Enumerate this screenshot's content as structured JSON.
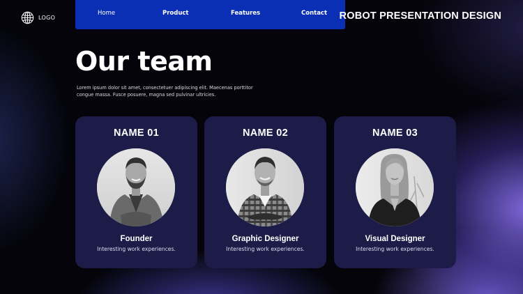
{
  "header": {
    "logo_text": "LOGO",
    "logo_icon": "globe-icon",
    "brand_title": "ROBOT PRESENTATION DESIGN"
  },
  "nav": {
    "items": [
      {
        "label": "Home"
      },
      {
        "label": "Product"
      },
      {
        "label": "Features"
      },
      {
        "label": "Contact"
      }
    ],
    "color": "#0a2fb4"
  },
  "main": {
    "title": "Our team",
    "description": "Lorem ipsum dolor sit amet, consectetuer adipiscing elit. Maecenas porttitor congue massa. Fusce posuere, magna sed pulvinar ultricies."
  },
  "team": [
    {
      "name": "NAME 01",
      "role": "Founder",
      "subtitle": "Interesting work experiences."
    },
    {
      "name": "NAME 02",
      "role": "Graphic Designer",
      "subtitle": "Interesting work experiences."
    },
    {
      "name": "NAME 03",
      "role": "Visual Designer",
      "subtitle": "Interesting work experiences."
    }
  ],
  "colors": {
    "card_background": "#1d1c48",
    "accent_glow": "#846ee6"
  }
}
